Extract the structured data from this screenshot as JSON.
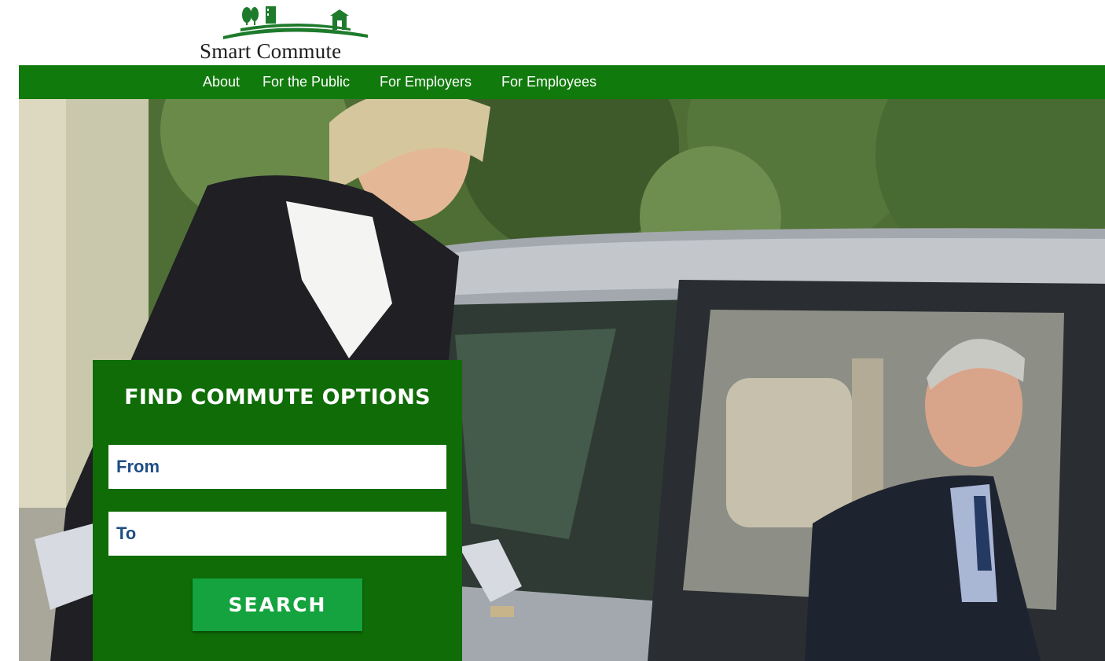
{
  "brand": {
    "name": "Smart Commute",
    "logo_color": "#1e7b2c"
  },
  "nav": {
    "background": "#117a0c",
    "items": [
      {
        "label": "About"
      },
      {
        "label": "For the Public"
      },
      {
        "label": "For Employers"
      },
      {
        "label": "For Employees"
      }
    ]
  },
  "hero": {
    "image": "photo of woman leaning towards a silver car with a man in the driver's seat"
  },
  "finder": {
    "title": "FIND COMMUTE OPTIONS",
    "from_placeholder": "From",
    "from_value": "",
    "to_placeholder": "To",
    "to_value": "",
    "search_label": "SEARCH",
    "panel_color": "#0f6c07",
    "button_color": "#14a33e",
    "input_text_color": "#1e4e86"
  }
}
